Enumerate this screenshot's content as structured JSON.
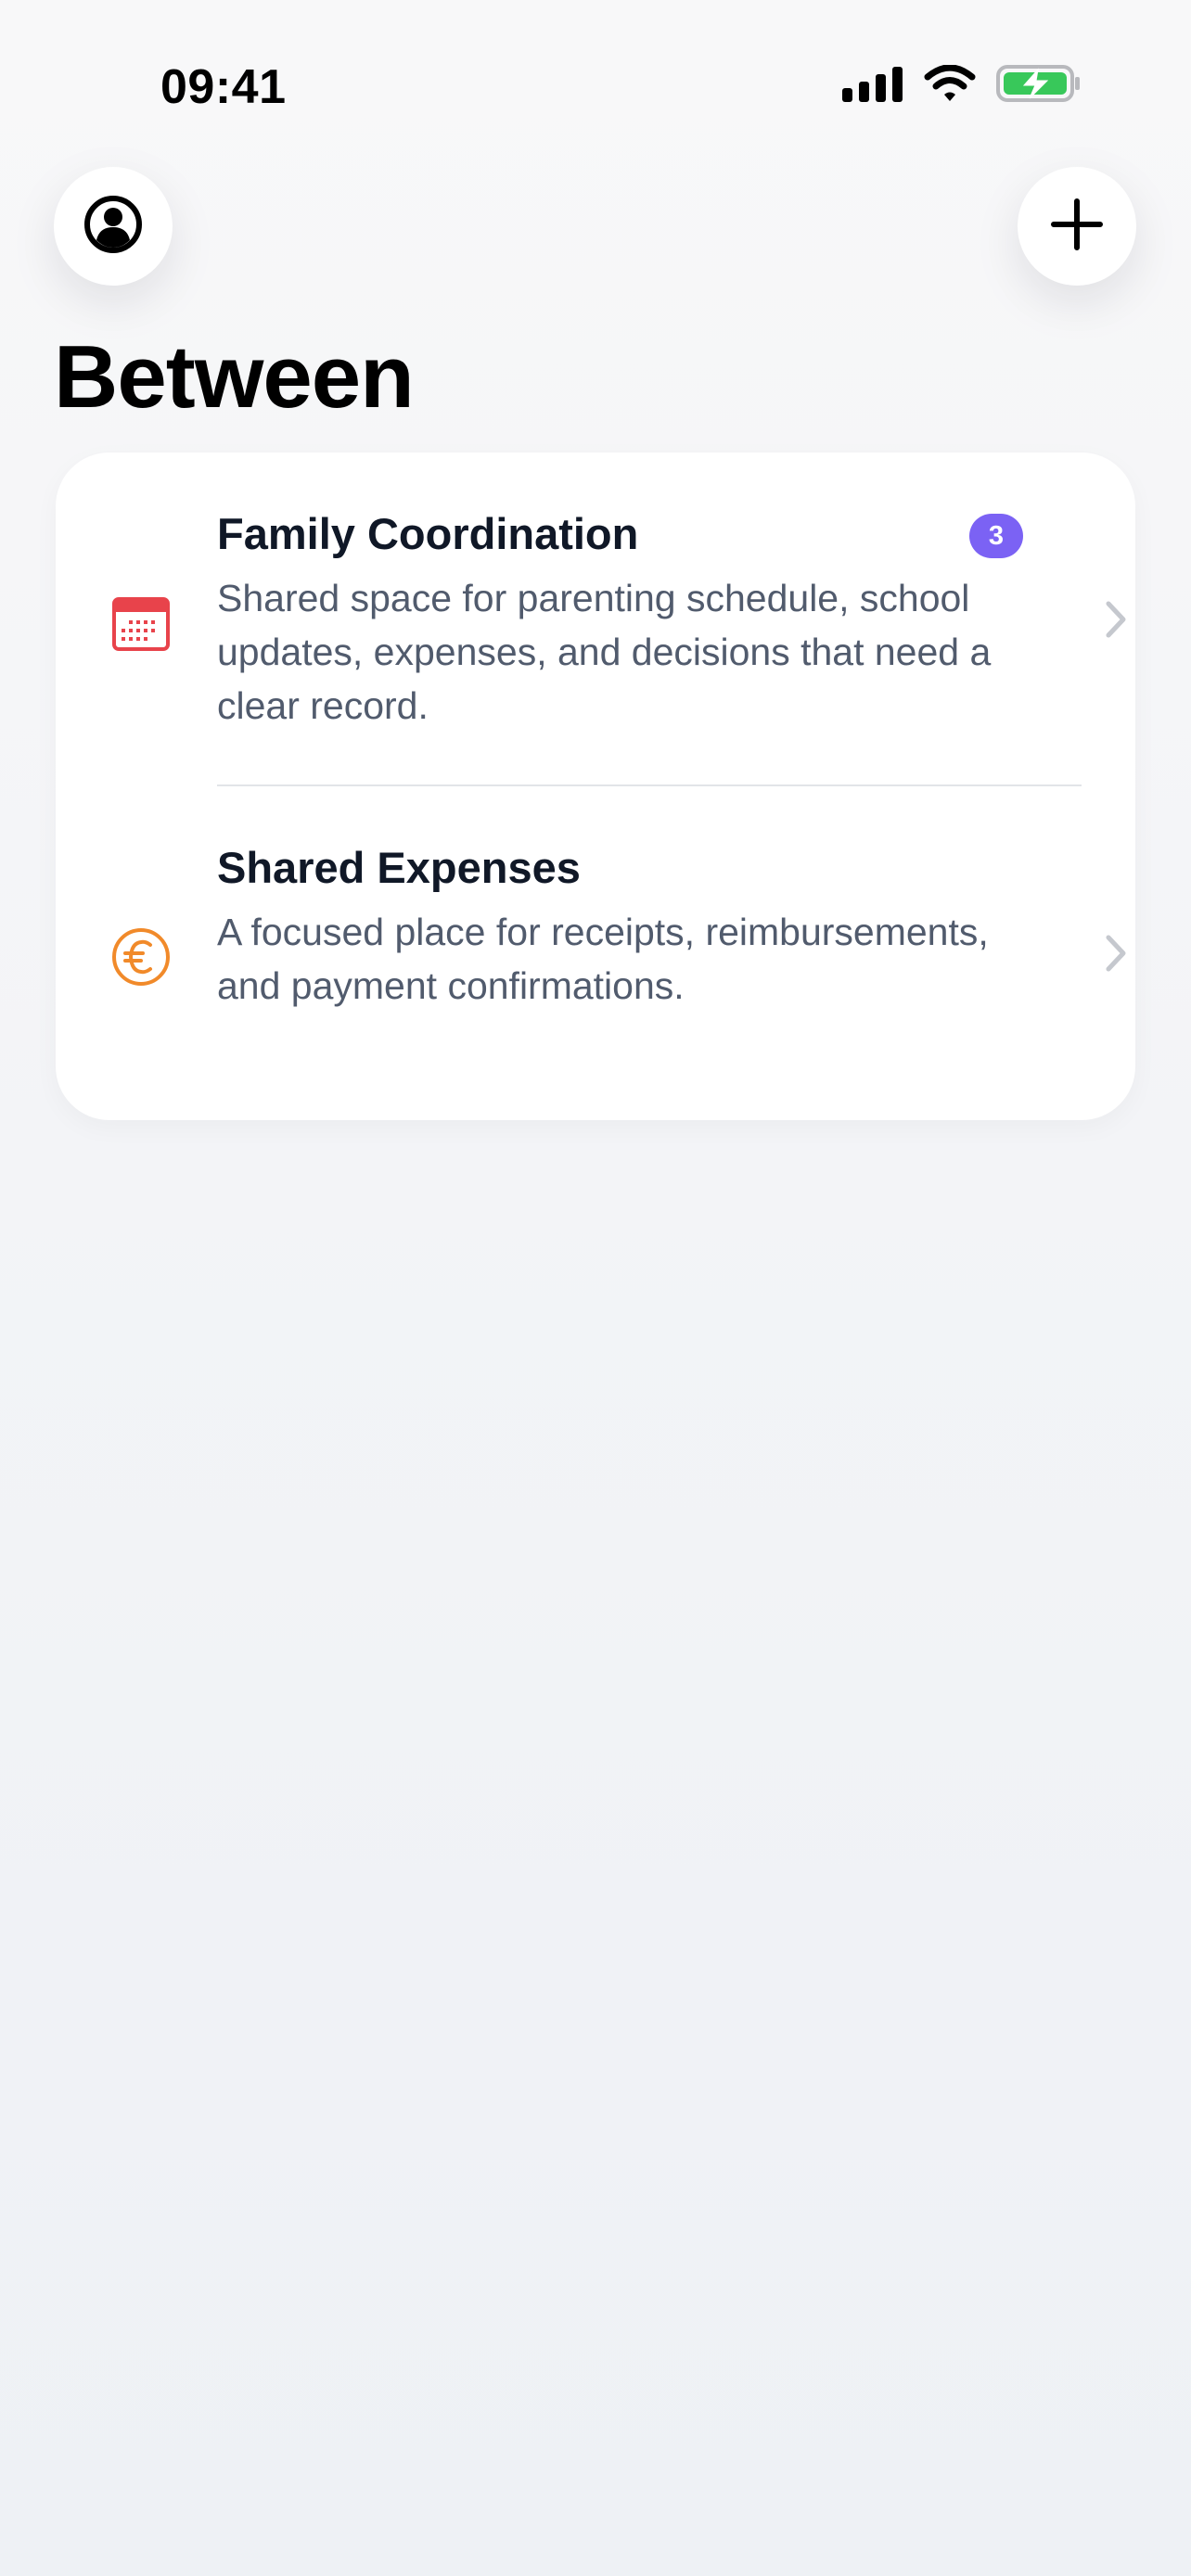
{
  "status_bar": {
    "time": "09:41"
  },
  "header": {
    "title": "Between",
    "profile_icon": "person-circle-icon",
    "add_icon": "plus-icon"
  },
  "spaces": [
    {
      "title": "Family Coordination",
      "description": "Shared space for parenting schedule, school updates, expenses, and decisions that need a clear record.",
      "badge": "3",
      "icon": "calendar-icon",
      "icon_color": "#e8434b",
      "badge_color": "#7b62f4"
    },
    {
      "title": "Shared Expenses",
      "description": "A focused place for receipts, reimbursements, and payment confirmations.",
      "icon": "euro-circle-icon",
      "icon_color": "#f18a2a"
    }
  ],
  "colors": {
    "background": "#f3f4f7",
    "card": "#ffffff",
    "title_text": "#101827",
    "body_text": "#515b6d",
    "chevron": "#c5c8ce",
    "battery_green": "#38c85a"
  }
}
